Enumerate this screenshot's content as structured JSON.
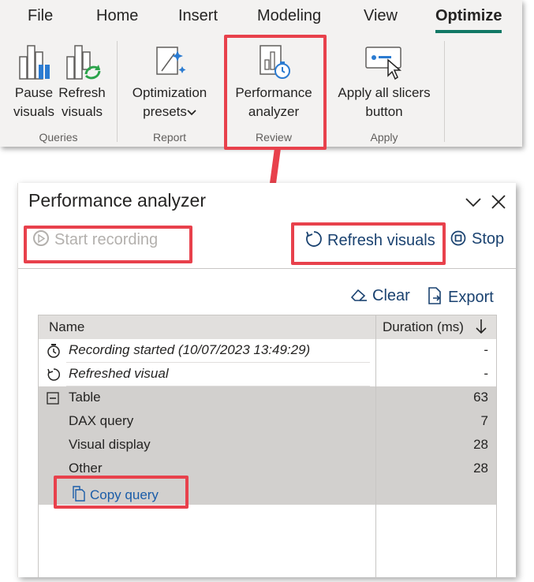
{
  "ribbon": {
    "tabs": [
      "File",
      "Home",
      "Insert",
      "Modeling",
      "View",
      "Optimize"
    ],
    "active_tab": "Optimize",
    "groups": {
      "queries": {
        "label": "Queries",
        "pause": [
          "Pause",
          "visuals"
        ],
        "refresh": [
          "Refresh",
          "visuals"
        ]
      },
      "report": {
        "label": "Report",
        "presets": [
          "Optimization",
          "presets"
        ]
      },
      "review": {
        "label": "Review",
        "perf": [
          "Performance",
          "analyzer"
        ]
      },
      "apply": {
        "label": "Apply",
        "slicers": [
          "Apply all slicers",
          "button"
        ]
      }
    }
  },
  "pane": {
    "title": "Performance analyzer",
    "start_recording": "Start recording",
    "refresh_visuals": "Refresh visuals",
    "stop": "Stop",
    "clear": "Clear",
    "export": "Export",
    "table": {
      "col_name": "Name",
      "col_duration": "Duration (ms)",
      "rows": [
        {
          "name": "Recording started (10/07/2023 13:49:29)",
          "duration": "-"
        },
        {
          "name": "Refreshed visual",
          "duration": "-"
        },
        {
          "name": "Table",
          "duration": "63"
        },
        {
          "name": "DAX query",
          "duration": "7"
        },
        {
          "name": "Visual display",
          "duration": "28"
        },
        {
          "name": "Other",
          "duration": "28"
        }
      ],
      "copy_query": "Copy query"
    }
  },
  "colors": {
    "accent": "#117865",
    "highlight": "#e8414c",
    "link": "#1a4270"
  }
}
